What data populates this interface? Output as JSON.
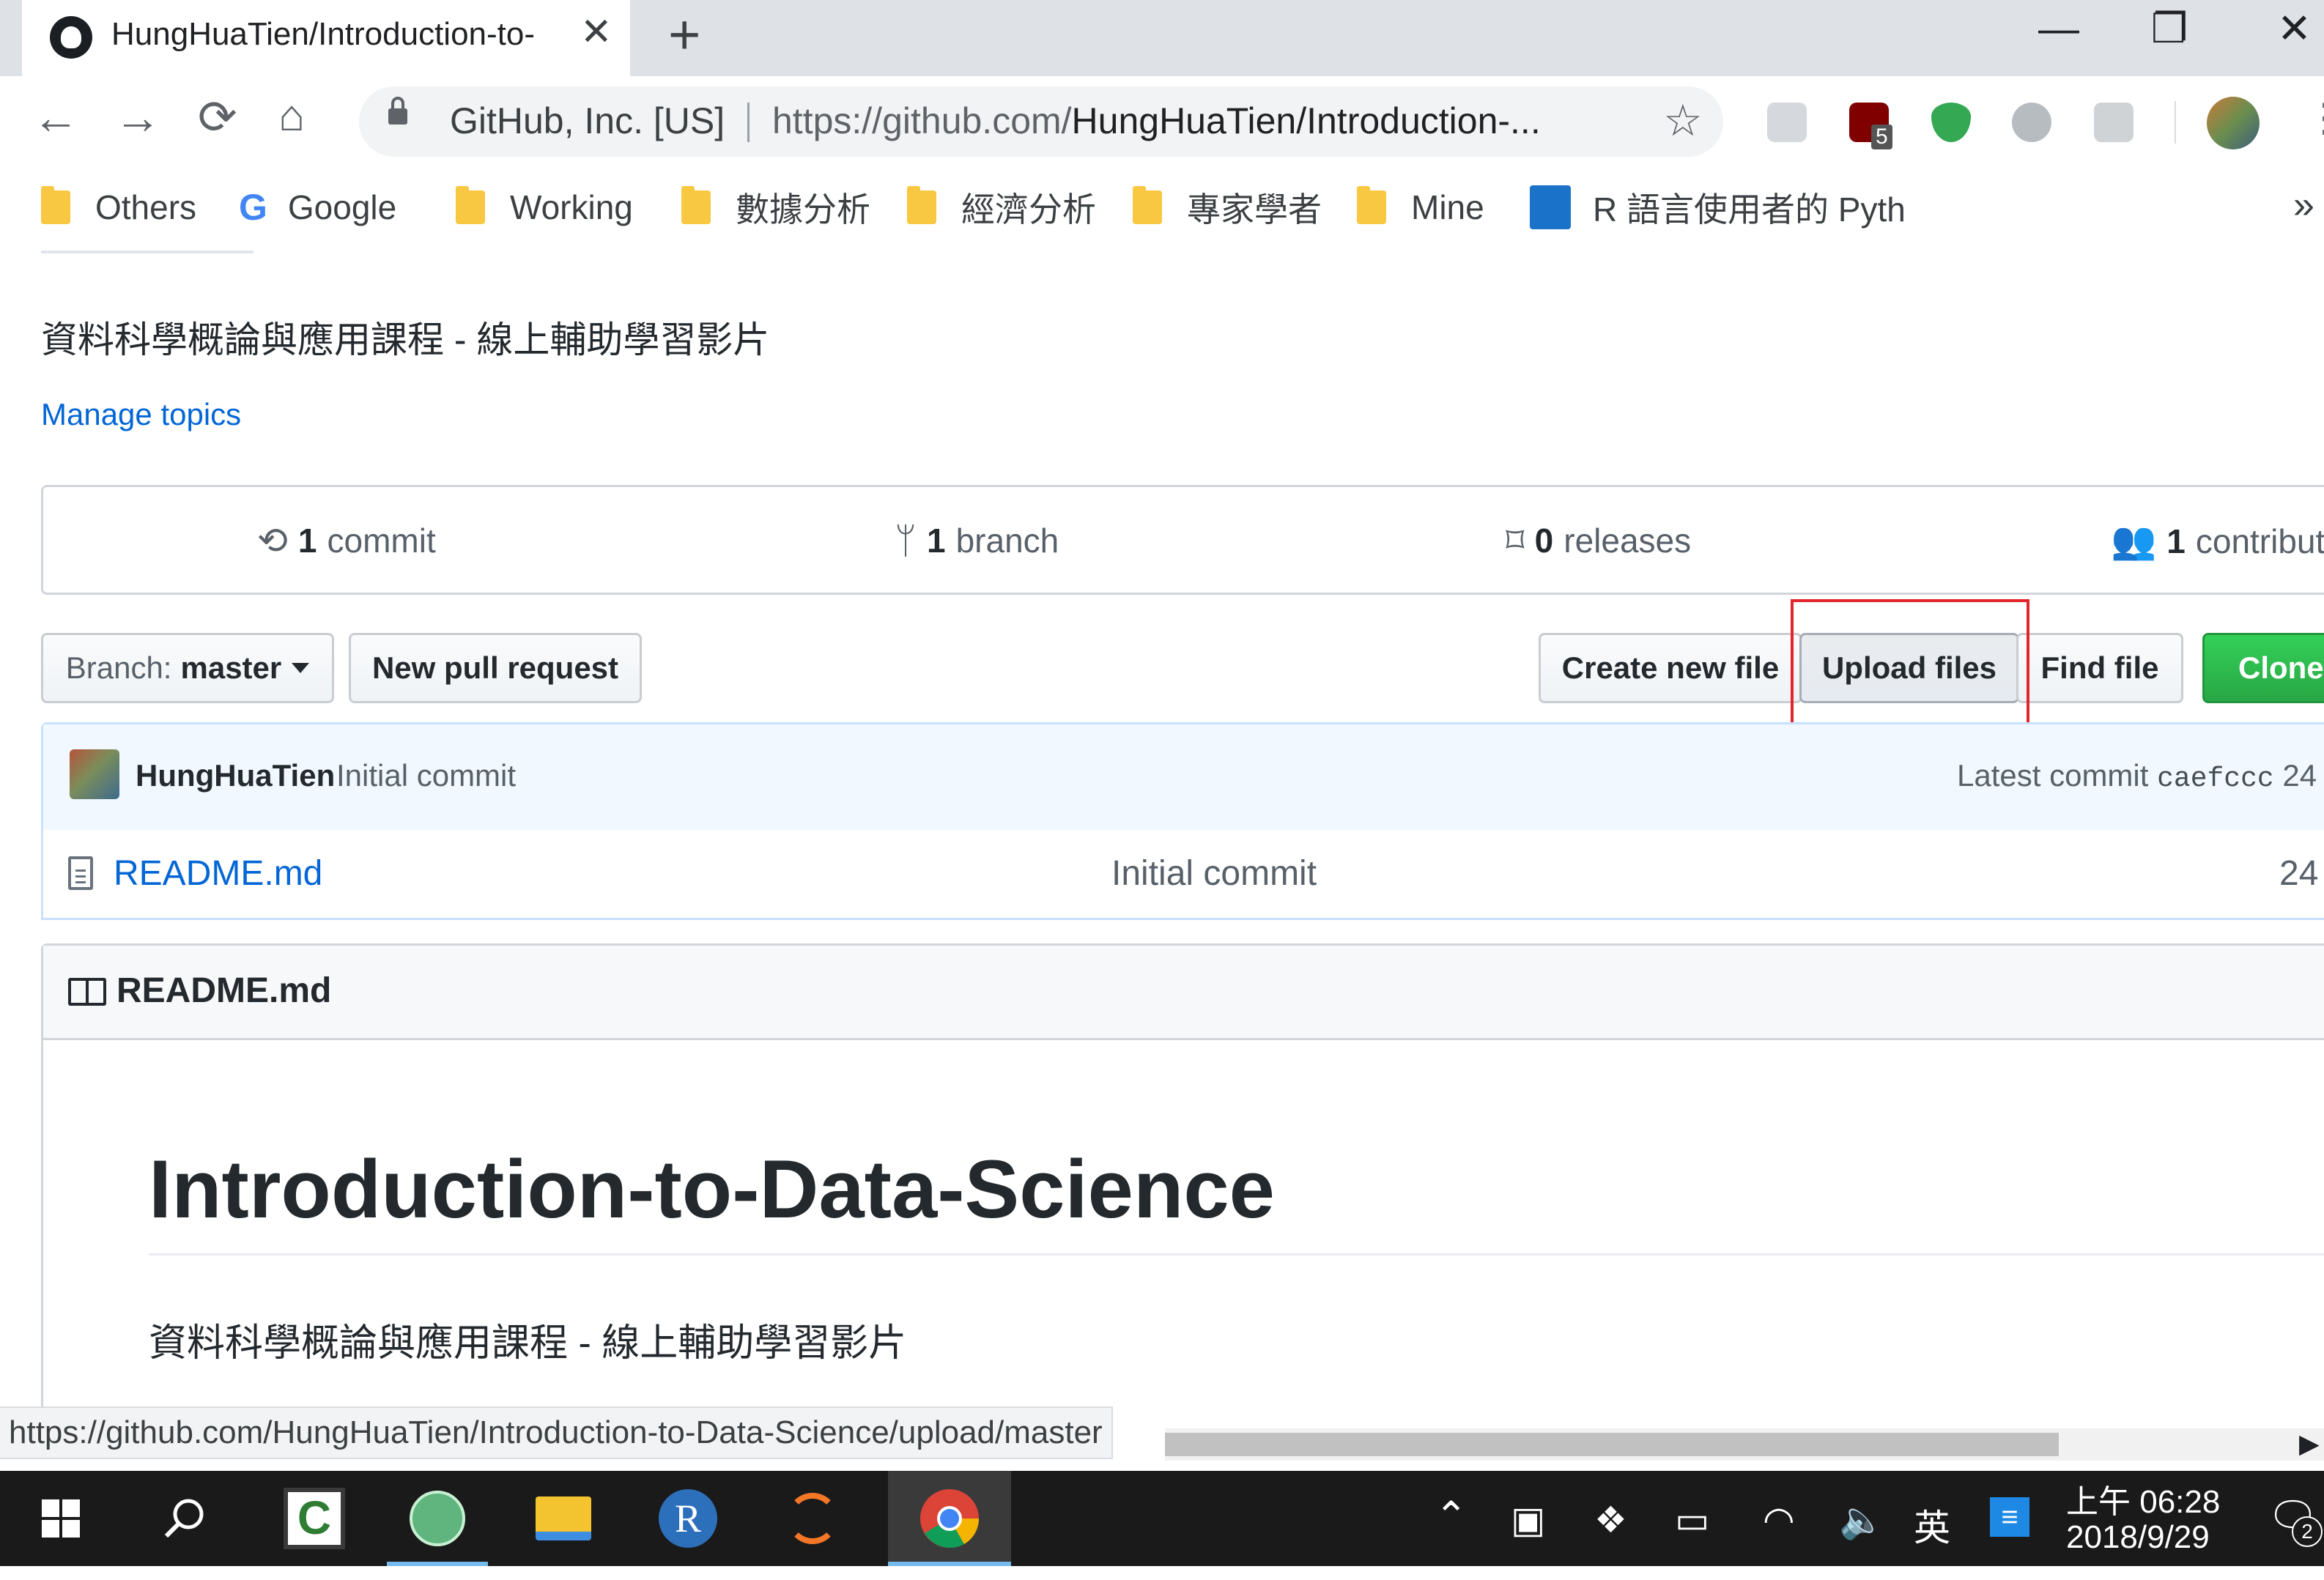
{
  "browser": {
    "tab_title": "HungHuaTien/Introduction-to-",
    "tab_close": "✕",
    "new_tab": "+",
    "window_controls": [
      "—",
      "❐",
      "✕"
    ],
    "security_label": "GitHub, Inc. [US]",
    "url_host": "https://github.com/",
    "url_path": "HungHuaTien/Introduction-...",
    "extensions": [
      {
        "name": "dropbox-icon",
        "color": "#a8b0b8"
      },
      {
        "name": "ublock-icon",
        "color": "#800000",
        "badge": "5"
      },
      {
        "name": "shield-icon",
        "color": "#34a853"
      },
      {
        "name": "grammarly-icon",
        "color": "#9aa0a6"
      },
      {
        "name": "pdf-icon",
        "color": "#c0c4c8"
      }
    ]
  },
  "bookmarks": {
    "items": [
      {
        "label": "Others",
        "icon": "folder-icon"
      },
      {
        "label": "Google",
        "icon": "google-icon"
      },
      {
        "label": "Working",
        "icon": "folder-icon"
      },
      {
        "label": "數據分析",
        "icon": "folder-icon"
      },
      {
        "label": "經濟分析",
        "icon": "folder-icon"
      },
      {
        "label": "專家學者",
        "icon": "folder-icon"
      },
      {
        "label": "Mine",
        "icon": "folder-icon"
      },
      {
        "label": "R 語言使用者的 Pyth",
        "icon": "site-icon"
      }
    ],
    "overflow": "»"
  },
  "repo": {
    "description": "資料科學概論與應用課程 - 線上輔助學習影片",
    "manage_topics": "Manage topics",
    "stats": {
      "commits_count": "1",
      "commits_label": "commit",
      "branches_count": "1",
      "branches_label": "branch",
      "releases_count": "0",
      "releases_label": "releases",
      "contributors_count": "1",
      "contributors_label": "contribut"
    },
    "nav": {
      "branch_prefix": "Branch:",
      "branch_name": "master",
      "new_pull_request": "New pull request",
      "create_new_file": "Create new file",
      "upload_files": "Upload files",
      "find_file": "Find file",
      "clone": "Clone o"
    },
    "commit_tease": {
      "author": "HungHuaTien",
      "message": "Initial commit",
      "latest_label": "Latest commit",
      "sha": "caefccc",
      "age": "24"
    },
    "files": [
      {
        "name": "README.md",
        "message": "Initial commit",
        "age": "24"
      }
    ],
    "readme": {
      "header": "README.md",
      "h1": "Introduction-to-Data-Science",
      "paragraph": "資料科學概論與應用課程 - 線上輔助學習影片"
    },
    "status_url": "https://github.com/HungHuaTien/Introduction-to-Data-Science/upload/master"
  },
  "taskbar": {
    "apps": [
      "windows-start-icon",
      "search-icon",
      "camtasia-icon",
      "atom-icon",
      "file-explorer-icon",
      "r-icon",
      "jupyter-icon",
      "chrome-icon"
    ],
    "tray": {
      "ime": "英",
      "time": "上午 06:28",
      "date": "2018/9/29",
      "notifications": "2"
    }
  }
}
